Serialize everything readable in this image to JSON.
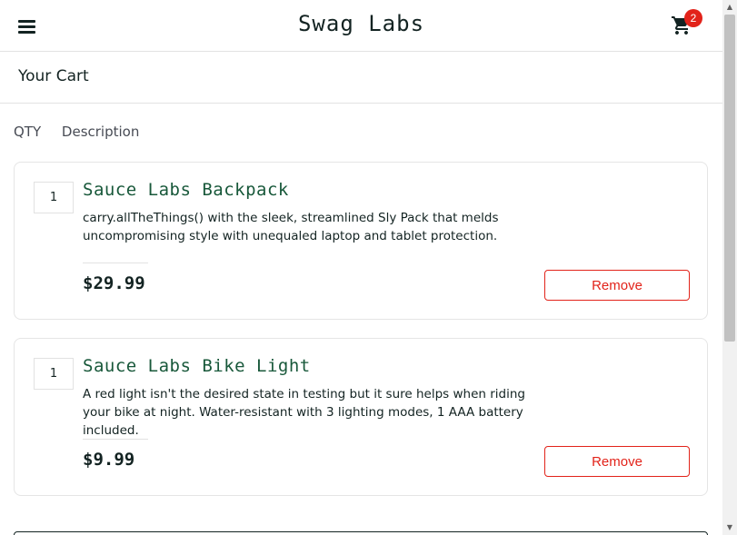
{
  "header": {
    "logo": "Swag Labs",
    "cart_count": "2"
  },
  "page_title": "Your Cart",
  "columns": {
    "qty": "QTY",
    "description": "Description"
  },
  "items": [
    {
      "qty": "1",
      "name": "Sauce Labs Backpack",
      "description": "carry.allTheThings() with the sleek, streamlined Sly Pack that melds uncompromising style with unequaled laptop and tablet protection.",
      "price": "$29.99",
      "remove_label": "Remove"
    },
    {
      "qty": "1",
      "name": "Sauce Labs Bike Light",
      "description": "A red light isn't the desired state in testing but it sure helps when riding your bike at night. Water-resistant with 3 lighting modes, 1 AAA battery included.",
      "price": "$9.99",
      "remove_label": "Remove"
    }
  ],
  "icons": {
    "menu": "menu-icon",
    "cart": "shopping-cart-icon"
  },
  "colors": {
    "accent": "#e2231a",
    "product_name": "#18583a",
    "text": "#132322"
  }
}
